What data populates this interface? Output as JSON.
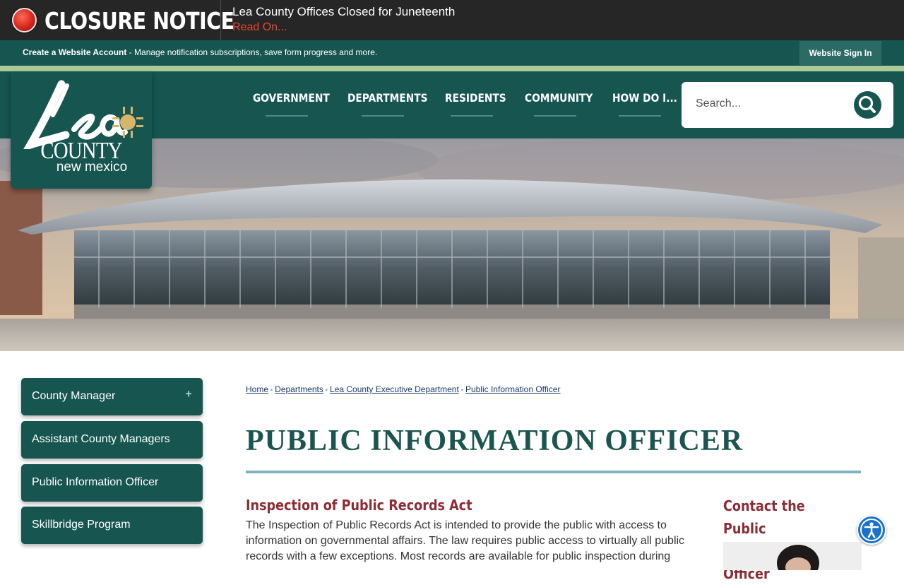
{
  "closure": {
    "title": "CLOSURE NOTICE",
    "headline": "Lea County Offices Closed for Juneteenth",
    "link": "Read On..."
  },
  "account_bar": {
    "create_label": "Create a Website Account",
    "create_desc": " - Manage notification subscriptions, save form progress and more.",
    "signin_label": "Website Sign In"
  },
  "logo": {
    "script_text": "Lea",
    "county": "COUNTY",
    "state": "new mexico"
  },
  "nav": {
    "items": [
      {
        "label": "GOVERNMENT"
      },
      {
        "label": "DEPARTMENTS"
      },
      {
        "label": "RESIDENTS"
      },
      {
        "label": "COMMUNITY"
      },
      {
        "label": "HOW DO I..."
      }
    ]
  },
  "search": {
    "placeholder": "Search..."
  },
  "sidebar": {
    "items": [
      {
        "label": "County Manager",
        "expand": "+"
      },
      {
        "label": "Assistant County Managers"
      },
      {
        "label": "Public Information Officer"
      },
      {
        "label": "Skillbridge Program"
      }
    ]
  },
  "breadcrumb": [
    "Home",
    "Departments",
    "Lea County Executive Department",
    "Public Information Officer"
  ],
  "main": {
    "title": "PUBLIC INFORMATION OFFICER",
    "section_heading": "Inspection of Public Records Act",
    "body": "The Inspection of Public Records Act is intended to provide the public with access to information on governmental affairs. The law requires public access to virtually all public records with a few exceptions. Most records are available for public inspection during",
    "contact_heading": "Contact the Public Information Officer"
  },
  "colors": {
    "brand_green": "#165550",
    "accent_red": "#8b2c34",
    "closure_red": "#e8462c",
    "rule_blue": "#7fb2c2"
  }
}
